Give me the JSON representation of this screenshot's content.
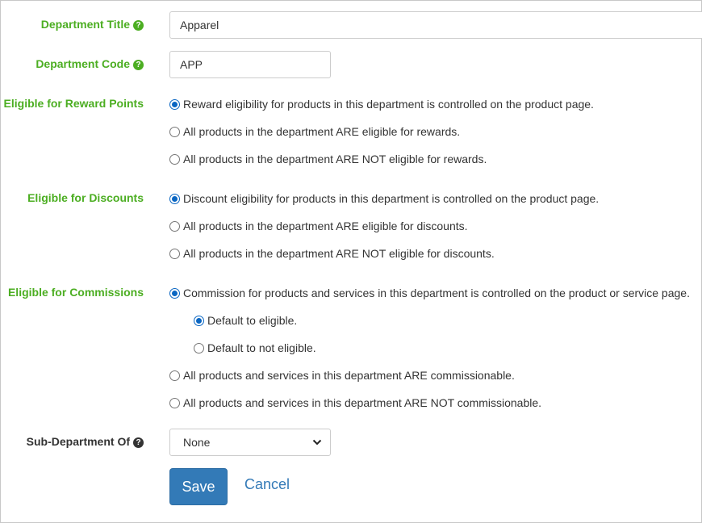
{
  "department_title": {
    "label": "Department Title",
    "help_icon": "question-circle-icon",
    "value": "Apparel"
  },
  "department_code": {
    "label": "Department Code",
    "help_icon": "question-circle-icon",
    "value": "APP"
  },
  "reward_points": {
    "label": "Eligible for Reward Points",
    "options": [
      {
        "label": "Reward eligibility for products in this department is controlled on the product page.",
        "checked": true
      },
      {
        "label": "All products in the department ARE eligible for rewards.",
        "checked": false
      },
      {
        "label": "All products in the department ARE NOT eligible for rewards.",
        "checked": false
      }
    ]
  },
  "discounts": {
    "label": "Eligible for Discounts",
    "options": [
      {
        "label": "Discount eligibility for products in this department is controlled on the product page.",
        "checked": true
      },
      {
        "label": "All products in the department ARE eligible for discounts.",
        "checked": false
      },
      {
        "label": "All products in the department ARE NOT eligible for discounts.",
        "checked": false
      }
    ]
  },
  "commissions": {
    "label": "Eligible for Commissions",
    "options": [
      {
        "label": "Commission for products and services in this department is controlled on the product or service page.",
        "checked": true
      },
      {
        "label": "Default to eligible.",
        "checked": true
      },
      {
        "label": "Default to not eligible.",
        "checked": false
      },
      {
        "label": "All products and services in this department ARE commissionable.",
        "checked": false
      },
      {
        "label": "All products and services in this department ARE NOT commissionable.",
        "checked": false
      }
    ]
  },
  "sub_department": {
    "label": "Sub-Department Of",
    "help_icon": "question-circle-icon",
    "selected": "None"
  },
  "actions": {
    "save_label": "Save",
    "cancel_label": "Cancel"
  },
  "colors": {
    "label_green": "#4cae22",
    "primary_blue": "#337ab7",
    "radio_blue": "#0a66c2"
  }
}
